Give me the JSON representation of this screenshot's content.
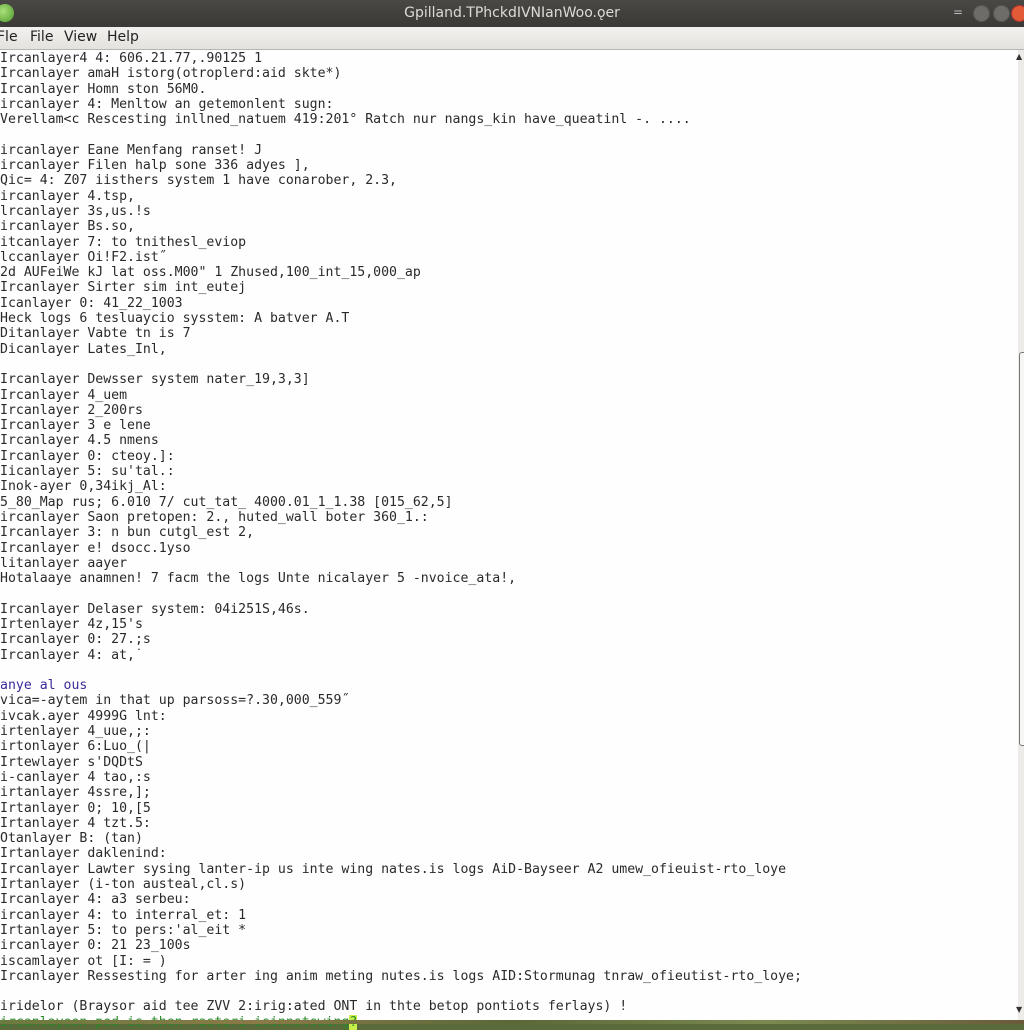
{
  "window": {
    "title": "Gpilland.TPhckdIVNIanWoo.ǫer",
    "controls": {
      "menu": "=",
      "minimize": "minimize",
      "maximize": "maximize",
      "close": "close"
    },
    "close_color": "#e25a36"
  },
  "menubar": {
    "items": [
      "Fle",
      "File",
      "View",
      "Help"
    ]
  },
  "log": {
    "lines": [
      {
        "text": "Ircanlayer4 4: 606.21.77,.90125 1"
      },
      {
        "text": "Ircanlayer amaH istorg(otroplerd:aid skte*)"
      },
      {
        "text": "Ircanlayer Homn ston 56M0."
      },
      {
        "text": "ircanlayer 4: Menltow an getemonlent sugn:"
      },
      {
        "text": "Verellam<c Rescesting inllned_natuem 419:201° Ratch nur nangs_kin have_queatinl -. ...."
      },
      {
        "text": ""
      },
      {
        "text": "ircanlayer Eane Menfang ranset! J"
      },
      {
        "text": "ircanlayer Filen halp sone 336 adyes ],"
      },
      {
        "text": "Qic= 4: Z07 iisthers system 1 have conarober, 2.3,"
      },
      {
        "text": "ircanlayer 4.tsp,"
      },
      {
        "text": "lrcanlayer 3s,us.!s"
      },
      {
        "text": "ircanlayer Bs.so,"
      },
      {
        "text": "itcanlayer 7: to tnithesl_eviop"
      },
      {
        "text": "lccanlayer Oi!F2.ist˝"
      },
      {
        "text": "2d AUFeiWe kJ lat oss.M00\" 1 Zhused,100_int_15,000_ap"
      },
      {
        "text": "Ircanlayer Sirter sim int_eutej"
      },
      {
        "text": "Icanlayer 0: 41_22_1003"
      },
      {
        "text": "Heck logs 6 tesluaycio sysstem: A batver A.T"
      },
      {
        "text": "Ditanlayer Vabte tn is 7"
      },
      {
        "text": "Dicanlayer Lates_Inl,"
      },
      {
        "text": ""
      },
      {
        "text": "Ircanlayer Dewsser system nater_19,3,3]"
      },
      {
        "text": "Ircanlayer 4_uem"
      },
      {
        "text": "Ircanlayer 2_200rs"
      },
      {
        "text": "Ircanlayer 3 e lene"
      },
      {
        "text": "Ircanlayer 4.5 nmens"
      },
      {
        "text": "Ircanlayer 0: cteoy.]:"
      },
      {
        "text": "Iicanlayer 5: su'tal.:"
      },
      {
        "text": "Inok-ayer 0,34ikj_Al:"
      },
      {
        "text": "5_80_Map rus; 6.010 7/ cut_tat_ 4000.01_1_1.38 [015_62,5]"
      },
      {
        "text": "ircanlayer Saon pretopen: 2., huted_wall boter 360_1.:"
      },
      {
        "text": "Ircanlayer 3: n bun cutgl_est 2,"
      },
      {
        "text": "Ircanlayer e! dsocc.1yso"
      },
      {
        "text": "litanlayer aayer"
      },
      {
        "text": "Hotalaaye anamnen! 7 facm the logs Unte nicalayer 5 -nvoice_ata!,"
      },
      {
        "text": ""
      },
      {
        "text": "Ircanlayer Delaser system: 04i251S,46s."
      },
      {
        "text": "Irtenlayer 4z,15's"
      },
      {
        "text": "Ircanlayer 0: 27.;s"
      },
      {
        "text": "Ircanlayer 4: at,˙"
      },
      {
        "text": ""
      },
      {
        "text": "anye al ous",
        "style": "blue"
      },
      {
        "text": "vica=-aytem in that up parsoss=?.30,000_559˝"
      },
      {
        "text": "ivcak.ayer 4999G lnt:"
      },
      {
        "text": "irtenlayer 4_uue,;:"
      },
      {
        "text": "irtonlayer 6:Luo_(|"
      },
      {
        "text": "Irtewlayer s'DQDtS"
      },
      {
        "text": "i-canlayer 4 tao,:s"
      },
      {
        "text": "irtanlayer 4ssre,];"
      },
      {
        "text": "Irtanlayer 0; 10,[5"
      },
      {
        "text": "Irtanlayer 4 tzt.5:"
      },
      {
        "text": "Otanlayer B: (tan)"
      },
      {
        "text": "Irtanlayer daklenind:"
      },
      {
        "text": "Ircanlayer Lawter sysing lanter-ip us inte wing nates.is logs AiD-Bayseer A2 umew_ofieuist-rto_loye"
      },
      {
        "text": "Irtanlayer (i-ton austeal,cl.s)"
      },
      {
        "text": "Ircanlayer 4: a3 serbeu:"
      },
      {
        "text": "ircanlayer 4: to interral_et: 1"
      },
      {
        "text": "Irtanlayer 5: to pers:'al_eit *"
      },
      {
        "text": "ircanlayer 0: 21 23_100s"
      },
      {
        "text": "iscamlayer ot [I: = )"
      },
      {
        "text": "Ircanlayer Ressesting for arter ing anim meting nutes.is logs AID:Stormunag tnraw_ofieutist-rto_loye;"
      },
      {
        "text": ""
      },
      {
        "text": "iridelor (Braysor aid tee ZVV 2:irig:ated ONT in thte betop pontiots ferlays) !"
      }
    ],
    "prompt_line": {
      "text": "ircanlayeon-pod is then rasteri isinnstswing",
      "cursor": "?",
      "color": "#2a8a2a",
      "cursor_color": "#c8f04a"
    }
  }
}
